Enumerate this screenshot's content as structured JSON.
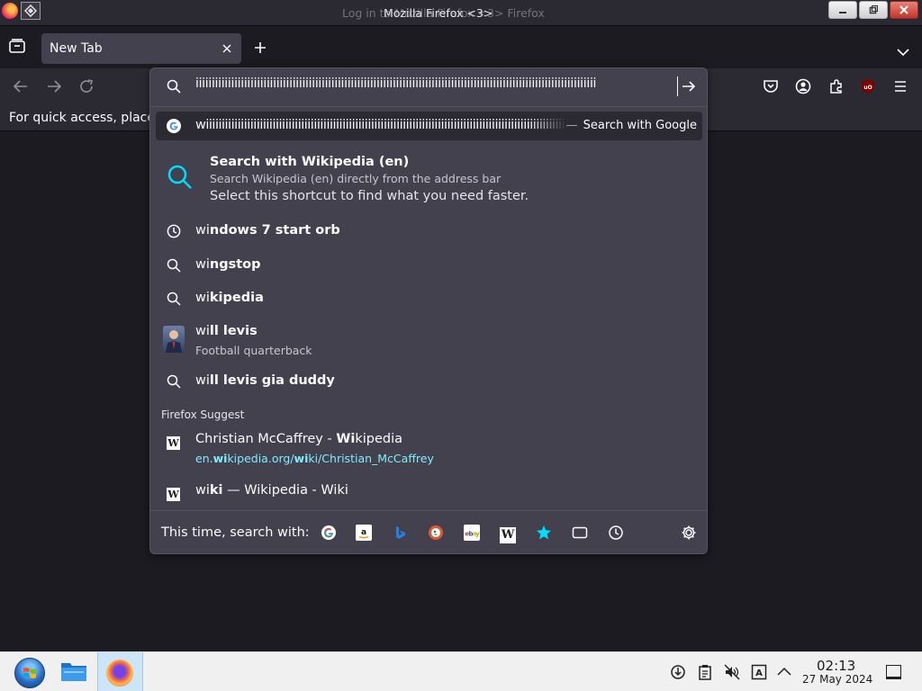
{
  "window": {
    "title_ghost": "Log in to Mozilla Firefox <3> Firefox",
    "title": "Mozilla Firefox <3>"
  },
  "tab": {
    "label": "New Tab"
  },
  "bookmarks_bar": {
    "hint": "For quick access, place y"
  },
  "urlbar": {
    "value": "iiiiiiiiiiiiiiiiiiiiiiiiiiiiiiiiiiiiiiiiiiiiiiiiiiiiiiiiiiiiiiiiiiiiiiiiiiiiiiiiiiiiiiiiiiiiiiiiiiiiiiiiiiiiiiiiiiiiiiiiiiii"
  },
  "suggestions": {
    "top": {
      "text": "wiiiiiiiiiiiiiiiiiiiiiiiiiiiiiiiiiiiiiiiiiiiiiiiiiiiiiiiiiiiiiiiiiiiiiiiiiiiiiiiiiiiiiiiiiiiiiiiiiiiiiiiiiiiiiiiiiiiiiii",
      "dash": "—",
      "action": "Search with Google"
    },
    "tip": {
      "title": "Search with Wikipedia (en)",
      "description": "Search Wikipedia (en) directly from the address bar",
      "hint": "Select this shortcut to find what you need faster."
    },
    "history": [
      {
        "typed": "wi",
        "rest": "ndows 7 start orb"
      },
      {
        "typed": "wi",
        "rest": "ngstop"
      },
      {
        "typed": "wi",
        "rest": "kipedia"
      },
      {
        "typed": "wi",
        "rest": "ll levis",
        "subtitle": "Football quarterback"
      },
      {
        "typed": "wi",
        "rest": "ll levis gia duddy"
      }
    ],
    "group_label": "Firefox Suggest",
    "firefox_suggest": [
      {
        "title_pre": "Christian McCaffrey - ",
        "title_match": "Wi",
        "title_post": "kipedia",
        "url_pre": "en.",
        "url_match1": "wi",
        "url_mid": "kipedia.org/",
        "url_match2": "wi",
        "url_post": "ki/Christian_McCaffrey"
      },
      {
        "typed": "wi",
        "rest": "ki",
        "post": " — Wikipedia - Wiki"
      }
    ]
  },
  "one_offs": {
    "label": "This time, search with:",
    "engines": [
      "Google",
      "Amazon",
      "Bing",
      "DuckDuckGo",
      "eBay",
      "Wikipedia (en)",
      "Bookmarks",
      "Tabs",
      "History"
    ],
    "settings_icon": "gear-icon"
  },
  "taskbar": {
    "time": "02:13",
    "date": "27 May 2024"
  },
  "colors": {
    "panel_bg": "#42414d",
    "toolbar_bg": "#2b2a33",
    "content_bg": "#1c1b22",
    "accent": "#00ddff",
    "link": "#80ebff"
  }
}
